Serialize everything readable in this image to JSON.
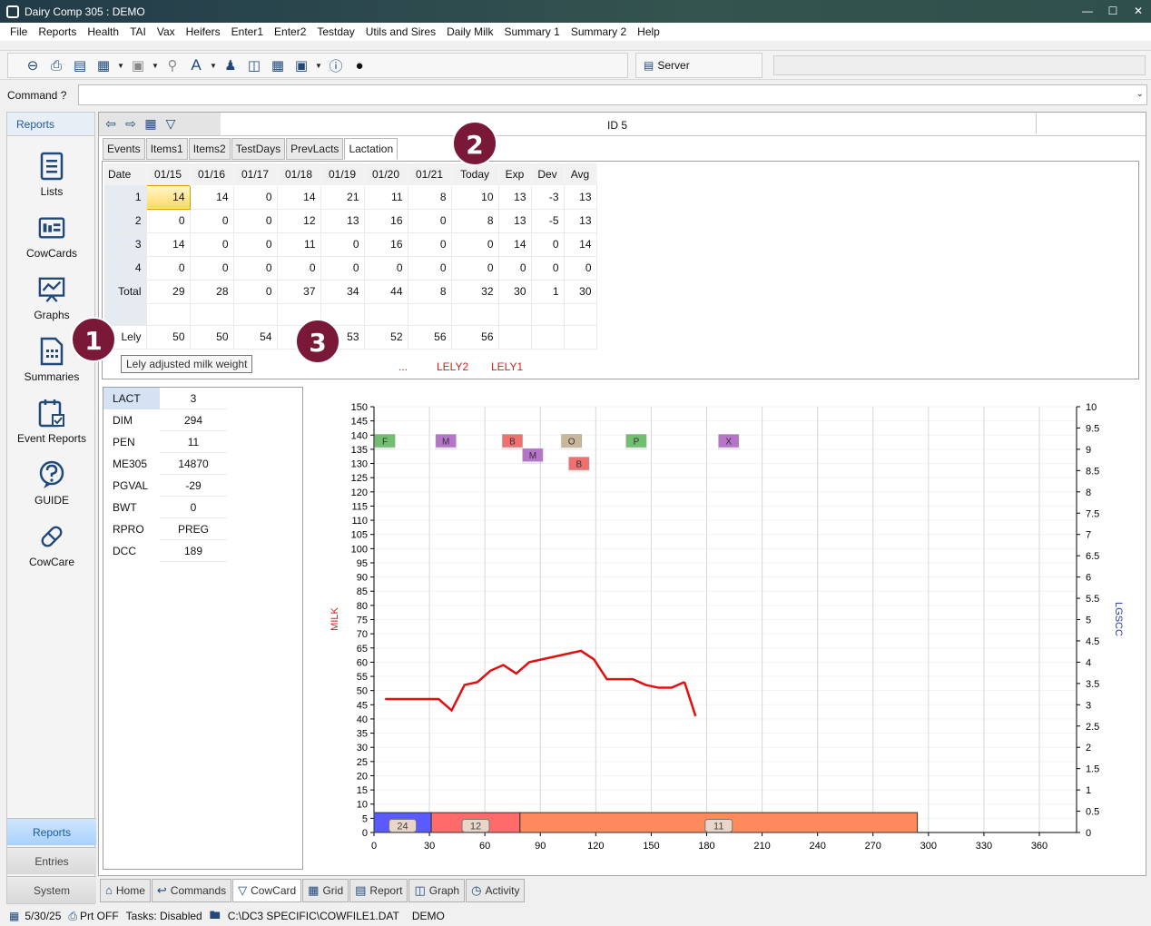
{
  "window": {
    "title": "Dairy Comp 305 : DEMO"
  },
  "menu": [
    "File",
    "Reports",
    "Health",
    "TAI",
    "Vax",
    "Heifers",
    "Enter1",
    "Enter2",
    "Testday",
    "Utils and Sires",
    "Daily Milk",
    "Summary 1",
    "Summary 2",
    "Help"
  ],
  "toolbar": {
    "server_label": "Server"
  },
  "command": {
    "label": "Command ?",
    "value": ""
  },
  "sidebar": {
    "header": "Reports",
    "items": [
      {
        "label": "Lists",
        "icon": "list-icon"
      },
      {
        "label": "CowCards",
        "icon": "cowcard-icon"
      },
      {
        "label": "Graphs",
        "icon": "graph-icon"
      },
      {
        "label": "Summaries",
        "icon": "summary-icon"
      },
      {
        "label": "Event Reports",
        "icon": "event-report-icon"
      },
      {
        "label": "GUIDE",
        "icon": "guide-icon"
      },
      {
        "label": "CowCare",
        "icon": "cowcare-icon"
      }
    ],
    "bottom": [
      "Reports",
      "Entries",
      "System"
    ]
  },
  "main": {
    "id_label": "ID 5",
    "tabs": [
      "Events",
      "Items1",
      "Items2",
      "TestDays",
      "PrevLacts",
      "Lactation"
    ],
    "active_tab": "Lactation",
    "grid": {
      "headers": [
        "Date",
        "01/15",
        "01/16",
        "01/17",
        "01/18",
        "01/19",
        "01/20",
        "01/21",
        "Today",
        "Exp",
        "Dev",
        "Avg"
      ],
      "rows": [
        {
          "label": "1",
          "values": [
            "14",
            "14",
            "0",
            "14",
            "21",
            "11",
            "8",
            "10",
            "13",
            "-3",
            "13"
          ]
        },
        {
          "label": "2",
          "values": [
            "0",
            "0",
            "0",
            "12",
            "13",
            "16",
            "0",
            "8",
            "13",
            "-5",
            "13"
          ]
        },
        {
          "label": "3",
          "values": [
            "14",
            "0",
            "0",
            "11",
            "0",
            "16",
            "0",
            "0",
            "14",
            "0",
            "14"
          ]
        },
        {
          "label": "4",
          "values": [
            "0",
            "0",
            "0",
            "0",
            "0",
            "0",
            "0",
            "0",
            "0",
            "0",
            "0"
          ]
        },
        {
          "label": "Total",
          "values": [
            "29",
            "28",
            "0",
            "37",
            "34",
            "44",
            "8",
            "32",
            "30",
            "1",
            "30"
          ]
        }
      ],
      "lely_row": {
        "label": "Lely",
        "values": [
          "50",
          "50",
          "54",
          "",
          "53",
          "52",
          "56",
          "56",
          "",
          "",
          ""
        ]
      },
      "tooltip": "Lely adjusted milk weight",
      "dots": "...",
      "lely2": "LELY2",
      "lely1": "LELY1"
    },
    "info": [
      {
        "key": "LACT",
        "value": "3"
      },
      {
        "key": "DIM",
        "value": "294"
      },
      {
        "key": "PEN",
        "value": "11"
      },
      {
        "key": "ME305",
        "value": "14870"
      },
      {
        "key": "PGVAL",
        "value": "-29"
      },
      {
        "key": "BWT",
        "value": "0"
      },
      {
        "key": "RPRO",
        "value": "PREG"
      },
      {
        "key": "DCC",
        "value": "189"
      }
    ],
    "badges": [
      "1",
      "2",
      "3"
    ]
  },
  "chart_data": {
    "type": "line",
    "ylabel": "MILK",
    "y2label": "LGSCC",
    "ylim": [
      0,
      150
    ],
    "y2lim": [
      0,
      10
    ],
    "xlim": [
      0,
      365
    ],
    "x_ticks": [
      0,
      30,
      60,
      90,
      120,
      150,
      180,
      210,
      240,
      270,
      300,
      330,
      360
    ],
    "y_ticks": [
      0,
      5,
      10,
      15,
      20,
      25,
      30,
      35,
      40,
      45,
      50,
      55,
      60,
      65,
      70,
      75,
      80,
      85,
      90,
      95,
      100,
      105,
      110,
      115,
      120,
      125,
      130,
      135,
      140,
      145,
      150
    ],
    "y2_ticks": [
      "0",
      "0.5",
      "1",
      "1.5",
      "2",
      "2.5",
      "3",
      "3.5",
      "4",
      "4.5",
      "5",
      "5.5",
      "6",
      "6.5",
      "7",
      "7.5",
      "8",
      "8.5",
      "9",
      "9.5",
      "10"
    ],
    "series": [
      {
        "color": "#e01010",
        "x": [
          6,
          28,
          35,
          42,
          49,
          56,
          63,
          70,
          77,
          84,
          91,
          98,
          105,
          112,
          119,
          126,
          133,
          140,
          147,
          154,
          161,
          168
        ],
        "y": [
          47,
          47,
          47,
          43,
          52,
          53,
          57,
          59,
          56,
          60,
          61,
          62,
          63,
          64,
          61,
          54,
          54,
          54,
          52,
          51,
          51,
          53
        ]
      }
    ],
    "extra_point": {
      "x": 174,
      "y": 41
    },
    "events": [
      {
        "label": "F",
        "x": 0,
        "y": 138,
        "color": "#6fbf6f"
      },
      {
        "label": "M",
        "x": 33,
        "y": 138,
        "color": "#b574c9"
      },
      {
        "label": "B",
        "x": 69,
        "y": 138,
        "color": "#f07070"
      },
      {
        "label": "M",
        "x": 80,
        "y": 133,
        "color": "#b574c9"
      },
      {
        "label": "O",
        "x": 101,
        "y": 138,
        "color": "#c9b79a"
      },
      {
        "label": "B",
        "x": 105,
        "y": 130,
        "color": "#f07070"
      },
      {
        "label": "P",
        "x": 136,
        "y": 138,
        "color": "#6fbf6f"
      },
      {
        "label": "X",
        "x": 186,
        "y": 138,
        "color": "#b574c9"
      }
    ],
    "pen_bars": [
      {
        "from": 0,
        "to": 31,
        "label": "24",
        "color": "#5a5aff"
      },
      {
        "from": 31,
        "to": 79,
        "label": "12",
        "color": "#ff6a6a"
      },
      {
        "from": 79,
        "to": 294,
        "label": "11",
        "color": "#ff8a5c"
      }
    ]
  },
  "bottom_tabs": [
    {
      "label": "Home",
      "icon": "home-icon"
    },
    {
      "label": "Commands",
      "icon": "commands-icon"
    },
    {
      "label": "CowCard",
      "icon": "cow-icon"
    },
    {
      "label": "Grid",
      "icon": "grid-icon"
    },
    {
      "label": "Report",
      "icon": "report-icon"
    },
    {
      "label": "Graph",
      "icon": "graph-icon"
    },
    {
      "label": "Activity",
      "icon": "activity-icon"
    }
  ],
  "status": {
    "date": "5/30/25",
    "printer": "Prt OFF",
    "tasks": "Tasks: Disabled",
    "path": "C:\\DC3 SPECIFIC\\COWFILE1.DAT",
    "herd": "DEMO"
  }
}
